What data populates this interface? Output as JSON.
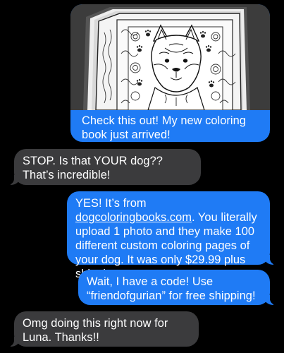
{
  "conversation": {
    "messages": [
      {
        "sender": "me",
        "has_image": true,
        "image_icon": "coloring-book-husky-page",
        "text": "Check this out! My new coloring book just arrived!"
      },
      {
        "sender": "them",
        "text": "STOP. Is that YOUR dog?? That’s incredible!"
      },
      {
        "sender": "me",
        "text_before_link": "YES! It’s from ",
        "link": "dogcoloringbooks.com",
        "text_after_link": ". You literally upload 1 photo and they make 100 different custom coloring pages of your dog. It was only $29.99 plus shipping."
      },
      {
        "sender": "me",
        "text": "Wait, I have a code! Use “friendofgurian” for free shipping!"
      },
      {
        "sender": "them",
        "text": "Omg doing this right now for Luna. Thanks!!"
      }
    ]
  },
  "colors": {
    "background": "#000000",
    "sent_bubble": "#1f7bf5",
    "received_bubble": "#3b3b3d",
    "text": "#ffffff"
  }
}
